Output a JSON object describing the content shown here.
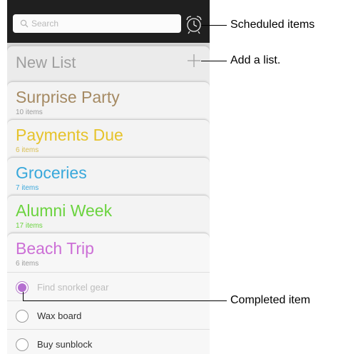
{
  "search": {
    "placeholder": "Search"
  },
  "icons": {
    "search": "magnifier-icon",
    "alarm": "alarm-clock-icon",
    "add": "plus-icon"
  },
  "new_list": {
    "label": "New List"
  },
  "lists": [
    {
      "title": "Surprise Party",
      "count": "10 items",
      "color": "#a58a63"
    },
    {
      "title": "Payments Due",
      "count": "6 items",
      "color": "#e6c32b"
    },
    {
      "title": "Groceries",
      "count": "7 items",
      "color": "#38a8db"
    },
    {
      "title": "Alumni Week",
      "count": "17 items",
      "color": "#6bd33f"
    },
    {
      "title": "Beach Trip",
      "count": "6 items",
      "color": "#cc6fd6"
    }
  ],
  "items": [
    {
      "label": "Find snorkel gear",
      "completed": true
    },
    {
      "label": "Wax board",
      "completed": false
    },
    {
      "label": "Buy sunblock",
      "completed": false
    }
  ],
  "callouts": {
    "scheduled": "Scheduled items",
    "add_list": "Add a list.",
    "completed": "Completed item"
  }
}
